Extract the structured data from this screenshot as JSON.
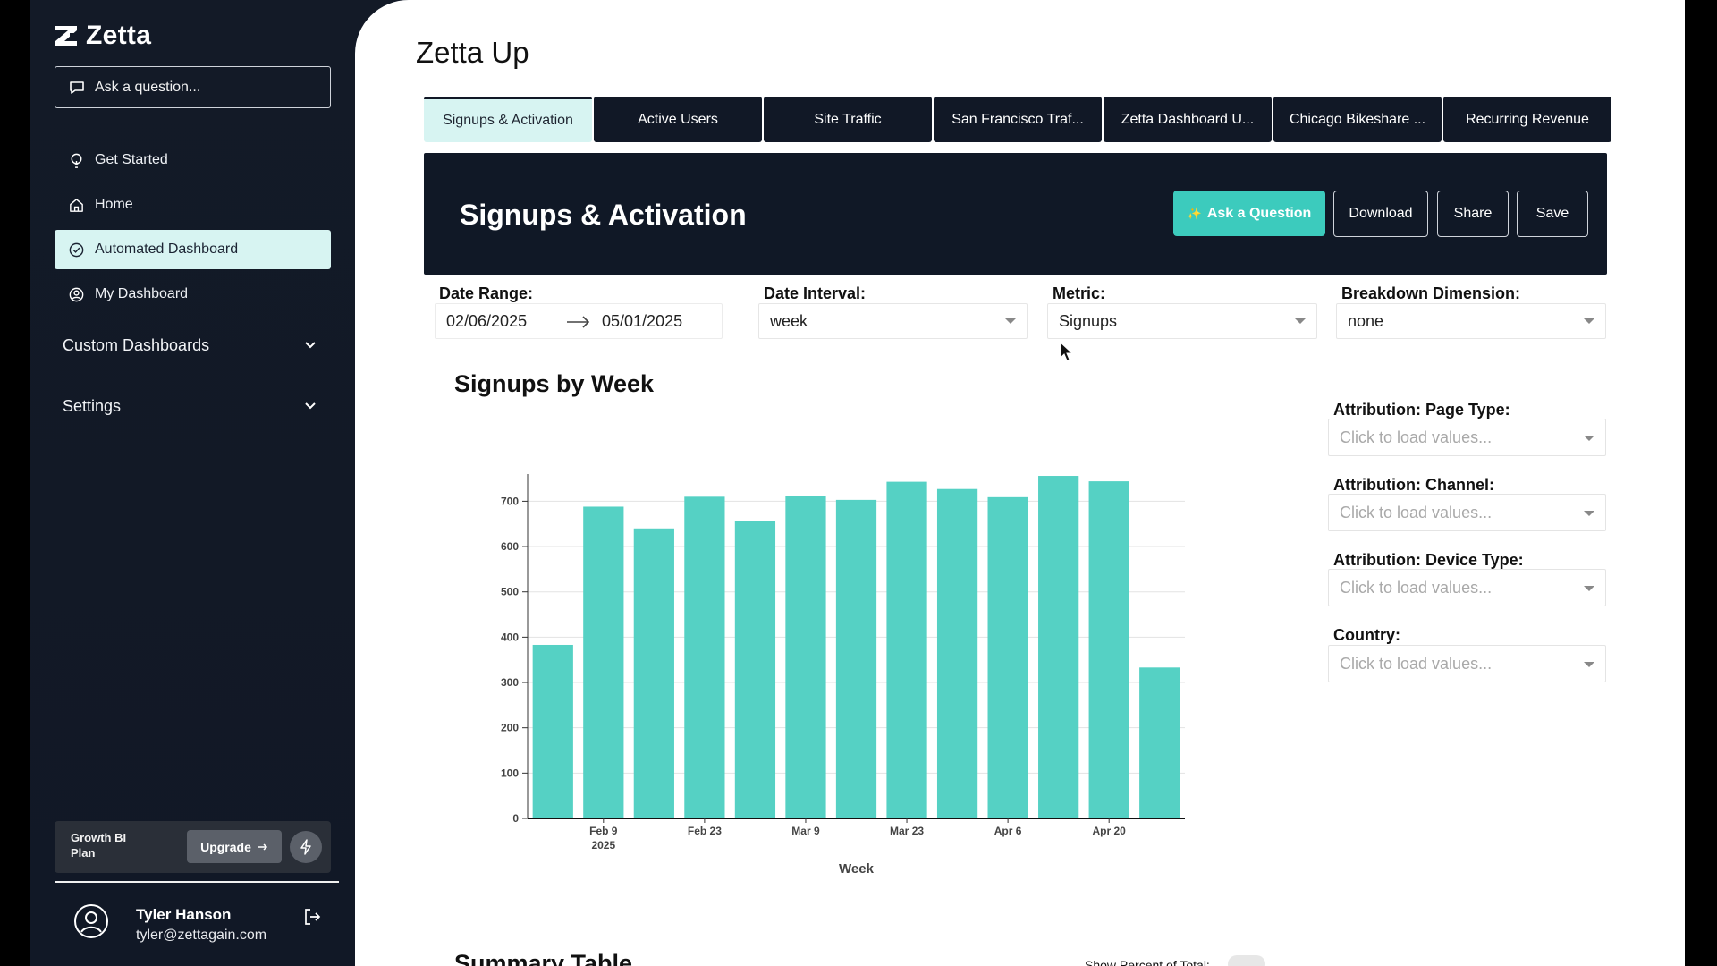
{
  "app": {
    "brand": "Zetta",
    "ask_placeholder": "Ask a question..."
  },
  "sidebar": {
    "items": [
      {
        "label": "Get Started",
        "icon": "lightbulb-icon"
      },
      {
        "label": "Home",
        "icon": "home-icon"
      },
      {
        "label": "Automated Dashboard",
        "icon": "check-circle-icon",
        "active": true
      },
      {
        "label": "My Dashboard",
        "icon": "user-circle-icon"
      }
    ],
    "sections": [
      {
        "label": "Custom Dashboards"
      },
      {
        "label": "Settings"
      }
    ],
    "plan": {
      "label": "Growth BI Plan",
      "upgrade": "Upgrade"
    },
    "user": {
      "name": "Tyler Hanson",
      "email": "tyler@zettagain.com"
    }
  },
  "main": {
    "title": "Zetta Up",
    "tabs": [
      {
        "label": "Signups & Activation",
        "active": true
      },
      {
        "label": "Active Users"
      },
      {
        "label": "Site Traffic"
      },
      {
        "label": "San Francisco Traf..."
      },
      {
        "label": "Zetta Dashboard U..."
      },
      {
        "label": "Chicago Bikeshare ..."
      },
      {
        "label": "Recurring Revenue"
      }
    ],
    "header": {
      "title": "Signups & Activation",
      "ask_button": "Ask a Question",
      "download": "Download",
      "share": "Share",
      "save": "Save"
    },
    "filters": {
      "date_range_label": "Date Range:",
      "date_start": "02/06/2025",
      "date_end": "05/01/2025",
      "interval_label": "Date Interval:",
      "interval_value": "week",
      "metric_label": "Metric:",
      "metric_value": "Signups",
      "breakdown_label": "Breakdown Dimension:",
      "breakdown_value": "none"
    },
    "chart_title": "Signups by Week",
    "attributions": [
      {
        "label": "Attribution: Page Type:",
        "placeholder": "Click to load values..."
      },
      {
        "label": "Attribution: Channel:",
        "placeholder": "Click to load values..."
      },
      {
        "label": "Attribution: Device Type:",
        "placeholder": "Click to load values..."
      },
      {
        "label": "Country:",
        "placeholder": "Click to load values..."
      }
    ],
    "summary_title": "Summary Table",
    "show_percent_label": "Show Percent of Total:"
  },
  "colors": {
    "sidebar_bg": "#131a27",
    "accent": "#3ccbbd",
    "bar": "#55d1c4",
    "active_tab": "#d7f4f2"
  },
  "chart_data": {
    "type": "bar",
    "title": "Signups by Week",
    "xlabel": "Week",
    "ylabel": "",
    "ylim": [
      0,
      760
    ],
    "yticks": [
      0,
      100,
      200,
      300,
      400,
      500,
      600,
      700
    ],
    "categories": [
      "2025-02-02",
      "2025-02-09",
      "2025-02-16",
      "2025-02-23",
      "2025-03-02",
      "2025-03-09",
      "2025-03-16",
      "2025-03-23",
      "2025-03-30",
      "2025-04-06",
      "2025-04-13",
      "2025-04-20",
      "2025-04-27"
    ],
    "xtick_labels": [
      {
        "category": "2025-02-09",
        "label": "Feb 9",
        "sublabel": "2025"
      },
      {
        "category": "2025-02-23",
        "label": "Feb 23"
      },
      {
        "category": "2025-03-09",
        "label": "Mar 9"
      },
      {
        "category": "2025-03-23",
        "label": "Mar 23"
      },
      {
        "category": "2025-04-06",
        "label": "Apr 6"
      },
      {
        "category": "2025-04-20",
        "label": "Apr 20"
      }
    ],
    "values": [
      383,
      688,
      640,
      710,
      657,
      711,
      703,
      743,
      727,
      709,
      756,
      744,
      333
    ],
    "grid": true
  }
}
